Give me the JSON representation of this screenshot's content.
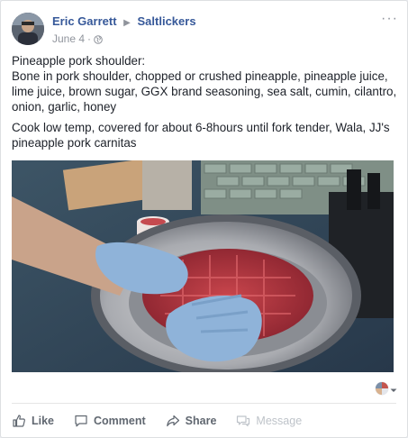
{
  "post": {
    "author": "Eric Garrett",
    "group": "Saltlickers",
    "date": "June 4",
    "dot": "·",
    "more": "···",
    "paragraphs": [
      "Pineapple pork shoulder:",
      "Bone in pork shoulder, chopped or crushed pineapple, pineapple juice, lime juice, brown sugar, GGX brand seasoning, sea salt, cumin, cilantro, onion, garlic, honey",
      "Cook low temp, covered for about 6-8hours until fork tender, Wala, JJ's pineapple pork carnitas"
    ]
  },
  "actions": {
    "like": "Like",
    "comment": "Comment",
    "share": "Share",
    "message": "Message"
  },
  "colors": {
    "link": "#365899",
    "muted": "#90949c",
    "action": "#606770"
  }
}
